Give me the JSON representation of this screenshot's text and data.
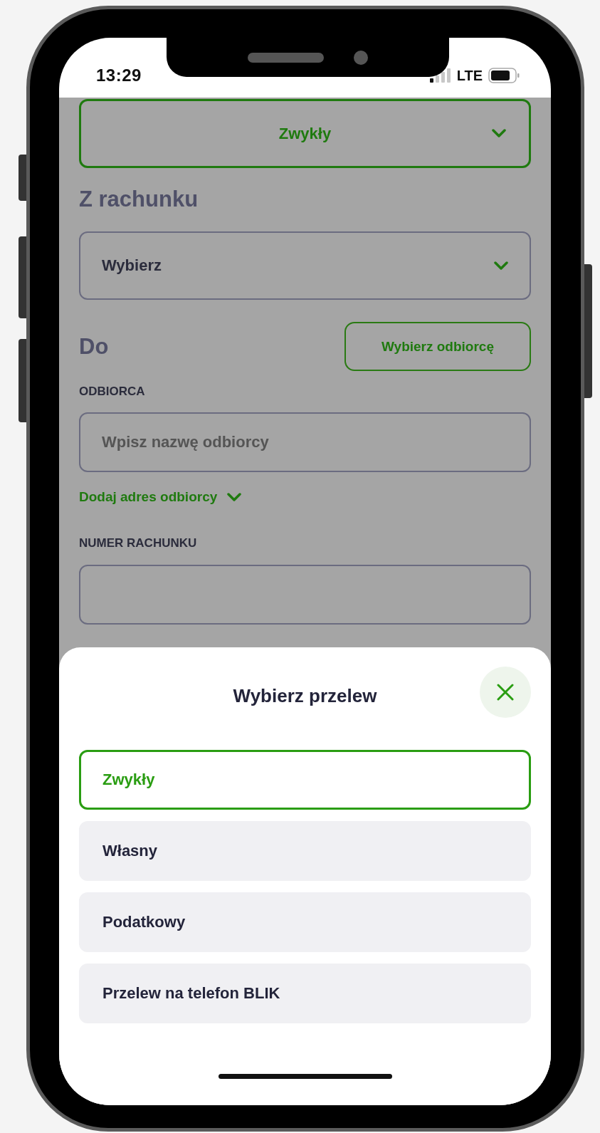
{
  "status_bar": {
    "time": "13:29",
    "network": "LTE"
  },
  "form": {
    "transfer_type": {
      "value": "Zwykły"
    },
    "from_heading": "Z rachunku",
    "account_select": {
      "value": "Wybierz"
    },
    "to_heading": "Do",
    "choose_recipient_button": "Wybierz odbiorcę",
    "recipient": {
      "label": "ODBIORCA",
      "placeholder": "Wpisz nazwę odbiorcy"
    },
    "add_address_link": "Dodaj adres odbiorcy",
    "account_number": {
      "label": "NUMER RACHUNKU"
    }
  },
  "sheet": {
    "title": "Wybierz przelew",
    "options": [
      {
        "label": "Zwykły",
        "selected": true
      },
      {
        "label": "Własny",
        "selected": false
      },
      {
        "label": "Podatkowy",
        "selected": false
      },
      {
        "label": "Przelew na telefon BLIK",
        "selected": false
      }
    ]
  }
}
